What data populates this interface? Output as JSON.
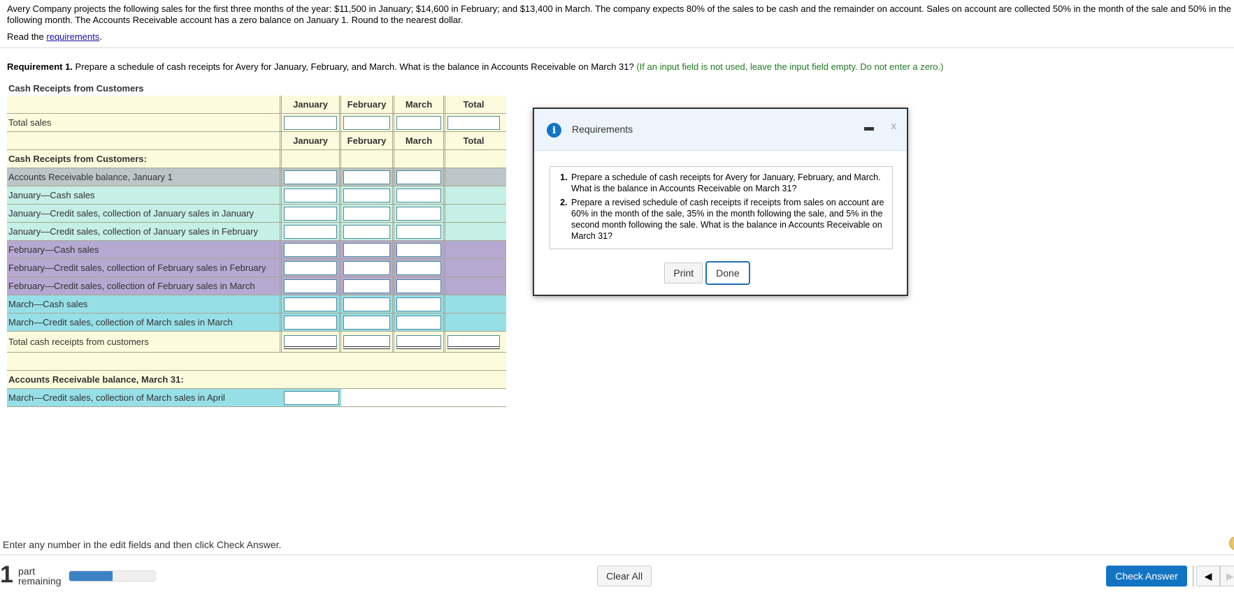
{
  "problem": {
    "intro": "Avery Company projects the following sales for the first three months of the year: $11,500 in January; $14,600 in February; and $13,400 in March. The company expects 80% of the sales to be cash and the remainder on account. Sales on account are collected 50% in the month of the sale and 50% in the following month. The Accounts Receivable account has a zero balance on January 1. Round to the nearest dollar.",
    "read_prefix": "Read the ",
    "read_link": "requirements",
    "read_suffix": ".",
    "req_label": "Requirement 1.",
    "req_text": " Prepare a schedule of cash receipts for Avery for January, February, and March. What is the balance in Accounts Receivable on March 31? ",
    "req_note": "(If an input field is not used, leave the input field empty. Do not enter a zero.)"
  },
  "table": {
    "title": "Cash Receipts from Customers",
    "columns": [
      "January",
      "February",
      "March",
      "Total"
    ],
    "total_sales_label": "Total sales",
    "section_label": "Cash Receipts from Customers:",
    "rows": [
      {
        "label": "Accounts Receivable balance, January 1",
        "values": [
          "",
          "",
          ""
        ]
      },
      {
        "label": "January—Cash sales",
        "values": [
          "",
          "",
          ""
        ]
      },
      {
        "label": "January—Credit sales, collection of January sales in January",
        "values": [
          "",
          "",
          ""
        ]
      },
      {
        "label": "January—Credit sales, collection of January sales in February",
        "values": [
          "",
          "",
          ""
        ]
      },
      {
        "label": "February—Cash sales",
        "values": [
          "",
          "",
          ""
        ]
      },
      {
        "label": "February—Credit sales, collection of February sales in February",
        "values": [
          "",
          "",
          ""
        ]
      },
      {
        "label": "February—Credit sales, collection of February sales in March",
        "values": [
          "",
          "",
          ""
        ]
      },
      {
        "label": "March—Cash sales",
        "values": [
          "",
          "",
          ""
        ]
      },
      {
        "label": "March—Credit sales, collection of March sales in March",
        "values": [
          "",
          "",
          ""
        ]
      }
    ],
    "total_receipts_label": "Total cash receipts from customers",
    "ar_section_label": "Accounts Receivable balance, March 31:",
    "ar_row_label": "March—Credit sales, collection of March sales in April"
  },
  "modal": {
    "title": "Requirements",
    "items": [
      "Prepare a schedule of cash receipts for Avery for January, February, and March. What is the balance in Accounts Receivable on March 31?",
      "Prepare a revised schedule of cash receipts if receipts from sales on account are 60% in the month of the sale, 35% in the month following the sale, and 5% in the second month following the sale. What is the balance in Accounts Receivable on March 31?"
    ],
    "print_label": "Print",
    "done_label": "Done",
    "close_glyph": "x"
  },
  "footer": {
    "instruction": "Enter any number in the edit fields and then click Check Answer.",
    "parts_count": "1",
    "parts_label_1": "part",
    "parts_label_2": "remaining",
    "progress_fraction": 0.5,
    "clear_all_label": "Clear All",
    "check_answer_label": "Check Answer",
    "prev_glyph": "◀",
    "next_glyph": "▶"
  },
  "colors": {
    "accent_blue": "#1474c4",
    "instruction_green": "#1f7a1f",
    "row_yellow": "#fdfbdd",
    "row_gray": "#bcc5c7",
    "row_teal": "#c6efe6",
    "row_purple": "#b5a9d1",
    "row_cyan": "#97dfe7"
  }
}
